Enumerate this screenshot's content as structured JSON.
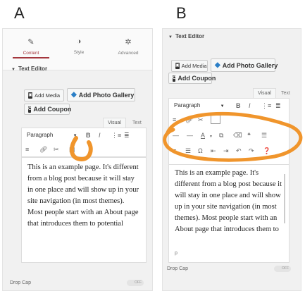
{
  "labels": {
    "a": "A",
    "b": "B"
  },
  "panel_a": {
    "tabs": [
      {
        "label": "Content",
        "icon": "pencil-icon"
      },
      {
        "label": "Style",
        "icon": "contrast-icon"
      },
      {
        "label": "Advanced",
        "icon": "gear-icon"
      }
    ],
    "section_title": "Text Editor",
    "add_media": "Add Media",
    "add_gallery": "Add Photo Gallery",
    "add_coupon": "Add Coupon",
    "visual_tab": "Visual",
    "text_tab": "Text",
    "format_select": "Paragraph",
    "content": "This is an example page. It's different from a blog post because it will stay in one place and will show up in your site navigation (in most themes). Most people start with an About page that introduces them to potential",
    "drop_cap": "Drop Cap",
    "drop_cap_toggle": "OFF"
  },
  "panel_b": {
    "section_title": "Text Editor",
    "add_media": "Add Media",
    "add_gallery": "Add Photo Gallery",
    "add_coupon": "Add Coupon",
    "visual_tab": "Visual",
    "text_tab": "Text",
    "format_select": "Paragraph",
    "content": "This is an example page. It's different from a blog post because it will stay in one place and will show up in your site navigation (in most themes). Most people start with an About page that introduces them to",
    "path": "p",
    "drop_cap": "Drop Cap",
    "drop_cap_toggle": "OFF"
  },
  "colors": {
    "highlight": "#f0952c",
    "accent": "#a4363d"
  }
}
